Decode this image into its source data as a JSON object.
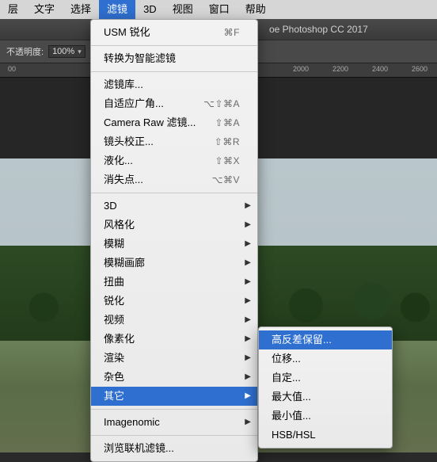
{
  "menubar": {
    "items": [
      "层",
      "文字",
      "选择",
      "滤镜",
      "3D",
      "视图",
      "窗口",
      "帮助"
    ],
    "activeIndex": 3
  },
  "docTitle": "oe Photoshop CC 2017",
  "options": {
    "opacityLabel": "不透明度:",
    "opacityValue": "100%"
  },
  "ruler": [
    "00",
    "2000",
    "2200",
    "2400",
    "2600"
  ],
  "menu": {
    "lastFilter": {
      "label": "USM 锐化",
      "shortcut": "⌘F"
    },
    "convertSmart": "转换为智能滤镜",
    "group1": [
      {
        "label": "滤镜库...",
        "shortcut": ""
      },
      {
        "label": "自适应广角...",
        "shortcut": "⌥⇧⌘A"
      },
      {
        "label": "Camera Raw 滤镜...",
        "shortcut": "⇧⌘A"
      },
      {
        "label": "镜头校正...",
        "shortcut": "⇧⌘R"
      },
      {
        "label": "液化...",
        "shortcut": "⇧⌘X"
      },
      {
        "label": "消失点...",
        "shortcut": "⌥⌘V"
      }
    ],
    "group2": [
      "3D",
      "风格化",
      "模糊",
      "模糊画廊",
      "扭曲",
      "锐化",
      "视频",
      "像素化",
      "渲染",
      "杂色",
      "其它"
    ],
    "highlightedIndex": 10,
    "plugin": "Imagenomic",
    "browse": "浏览联机滤镜..."
  },
  "submenu": {
    "items": [
      "高反差保留...",
      "位移...",
      "自定...",
      "最大值...",
      "最小值...",
      "HSB/HSL"
    ],
    "highlightedIndex": 0
  }
}
